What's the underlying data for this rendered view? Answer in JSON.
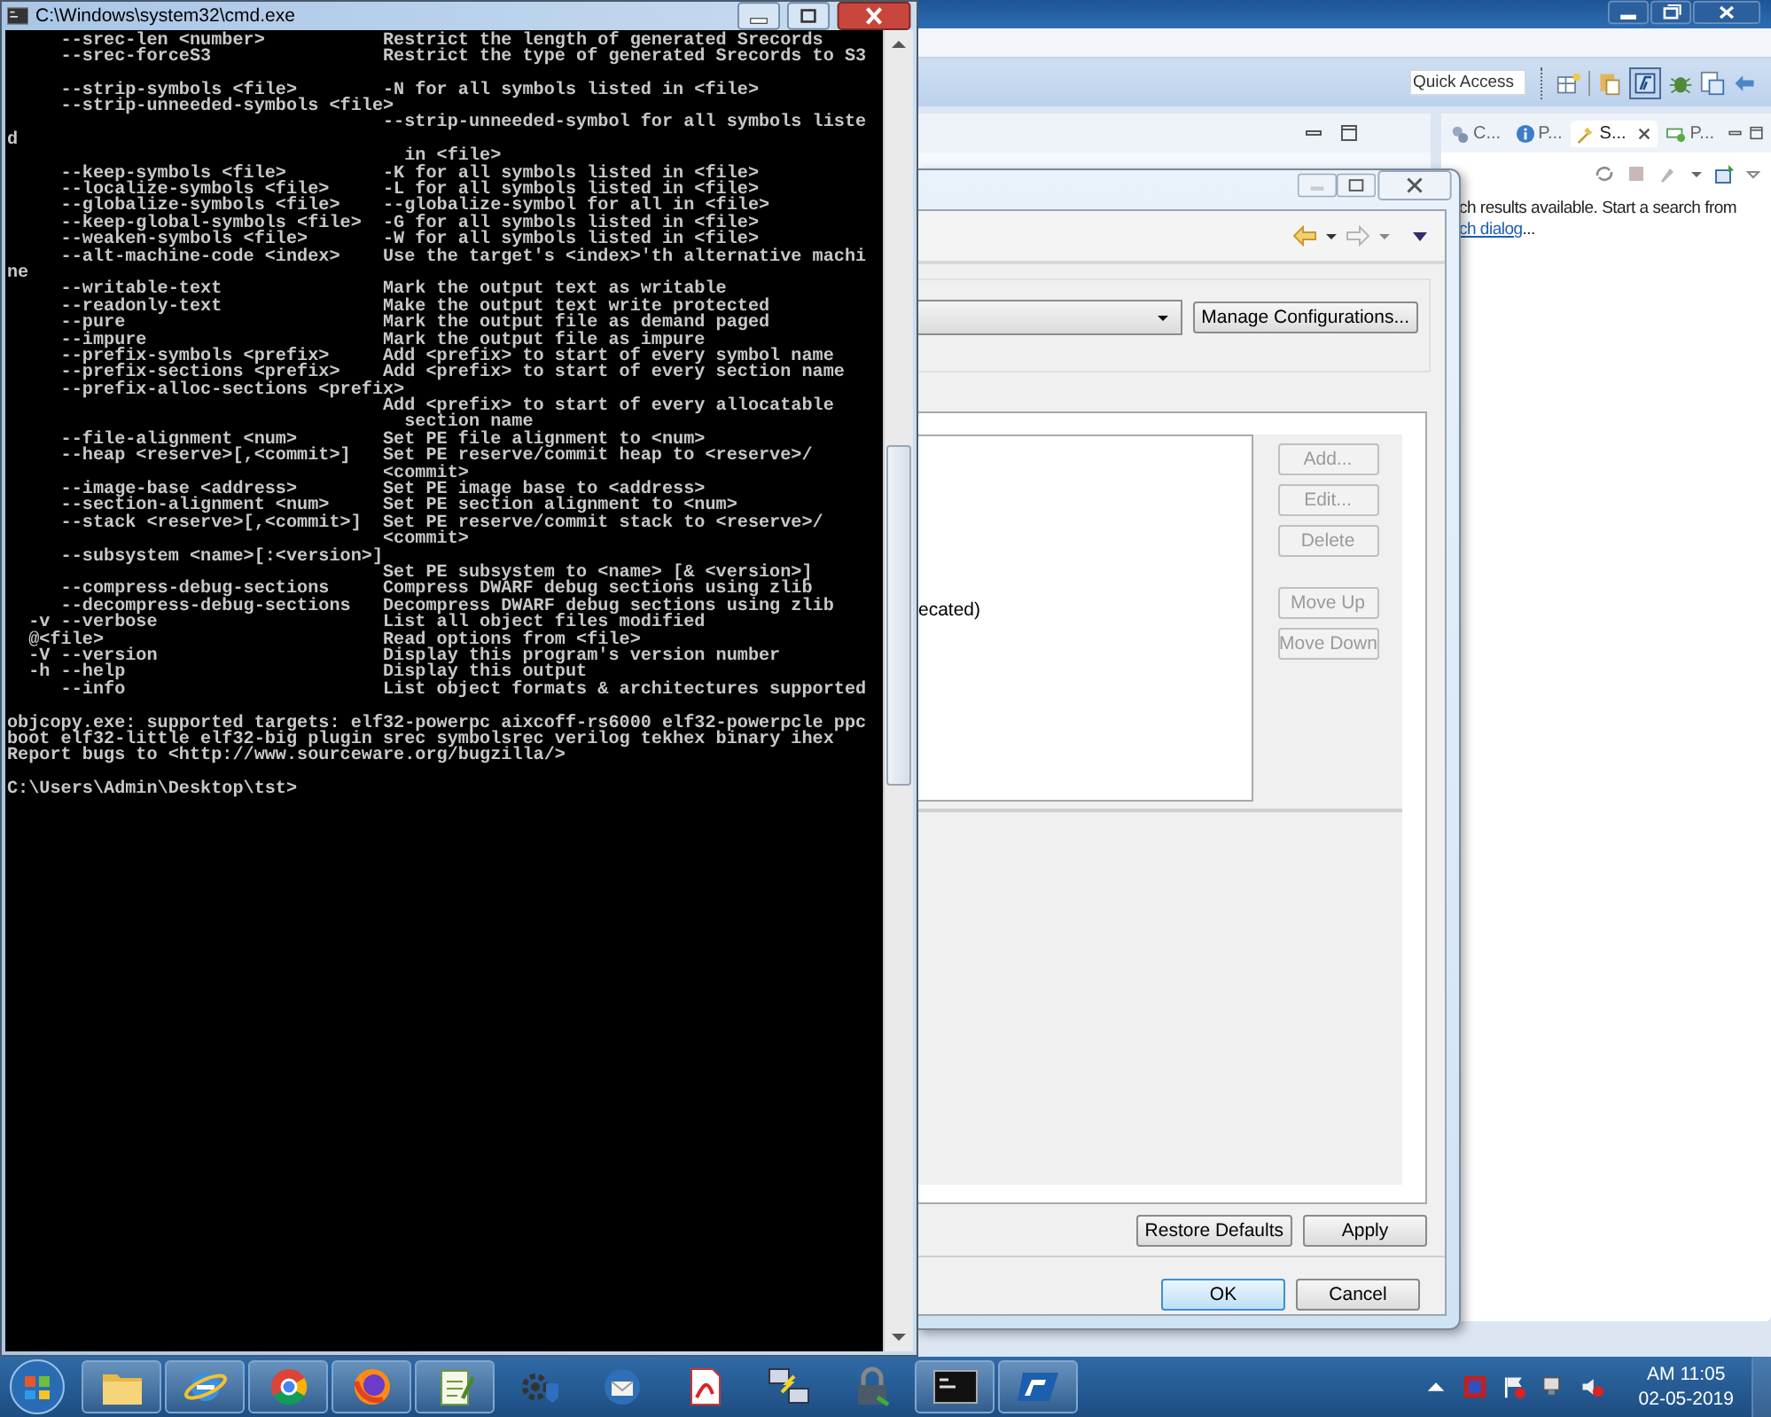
{
  "console": {
    "title": "C:\\Windows\\system32\\cmd.exe",
    "blocks": [
      [
        {
          "kind": "option",
          "option": "     --srec-len <number>",
          "description": "Restrict the length of generated Srecords"
        },
        {
          "kind": "option",
          "option": "     --srec-forceS3",
          "description": "Restrict the type of generated Srecords to S3"
        }
      ],
      [
        {
          "kind": "option",
          "option": "     --strip-symbols <file>",
          "description": "-N for all symbols listed in <file>"
        },
        {
          "kind": "option",
          "option": "     --strip-unneeded-symbols <file>"
        },
        {
          "kind": "continuation",
          "description": "--strip-unneeded-symbol for all symbols liste"
        },
        {
          "kind": "raw",
          "text": "d"
        },
        {
          "kind": "continuation",
          "description": "  in <file>"
        },
        {
          "kind": "option",
          "option": "     --keep-symbols <file>",
          "description": "-K for all symbols listed in <file>"
        },
        {
          "kind": "option",
          "option": "     --localize-symbols <file>",
          "description": "-L for all symbols listed in <file>"
        },
        {
          "kind": "option",
          "option": "     --globalize-symbols <file>",
          "description": "--globalize-symbol for all in <file>"
        },
        {
          "kind": "option",
          "option": "     --keep-global-symbols <file>",
          "description": "-G for all symbols listed in <file>"
        },
        {
          "kind": "option",
          "option": "     --weaken-symbols <file>",
          "description": "-W for all symbols listed in <file>"
        },
        {
          "kind": "option",
          "option": "     --alt-machine-code <index>",
          "description": "Use the target's <index>'th alternative machi"
        },
        {
          "kind": "raw",
          "text": "ne"
        },
        {
          "kind": "option",
          "option": "     --writable-text",
          "description": "Mark the output text as writable"
        },
        {
          "kind": "option",
          "option": "     --readonly-text",
          "description": "Make the output text write protected"
        },
        {
          "kind": "option",
          "option": "     --pure",
          "description": "Mark the output file as demand paged"
        },
        {
          "kind": "option",
          "option": "     --impure",
          "description": "Mark the output file as impure"
        },
        {
          "kind": "option",
          "option": "     --prefix-symbols <prefix>",
          "description": "Add <prefix> to start of every symbol name"
        },
        {
          "kind": "option",
          "option": "     --prefix-sections <prefix>",
          "description": "Add <prefix> to start of every section name"
        },
        {
          "kind": "option",
          "option": "     --prefix-alloc-sections <prefix>"
        },
        {
          "kind": "continuation",
          "description": "Add <prefix> to start of every allocatable"
        },
        {
          "kind": "continuation",
          "description": "  section name"
        },
        {
          "kind": "option",
          "option": "     --file-alignment <num>",
          "description": "Set PE file alignment to <num>"
        },
        {
          "kind": "option",
          "option": "     --heap <reserve>[,<commit>]",
          "description": "Set PE reserve/commit heap to <reserve>/"
        },
        {
          "kind": "continuation",
          "description": "<commit>"
        },
        {
          "kind": "option",
          "option": "     --image-base <address>",
          "description": "Set PE image base to <address>"
        },
        {
          "kind": "option",
          "option": "     --section-alignment <num>",
          "description": "Set PE section alignment to <num>"
        },
        {
          "kind": "option",
          "option": "     --stack <reserve>[,<commit>]",
          "description": "Set PE reserve/commit stack to <reserve>/"
        },
        {
          "kind": "continuation",
          "description": "<commit>"
        },
        {
          "kind": "option",
          "option": "     --subsystem <name>[:<version>]"
        },
        {
          "kind": "continuation",
          "description": "Set PE subsystem to <name> [& <version>]"
        },
        {
          "kind": "option",
          "option": "     --compress-debug-sections",
          "description": "Compress DWARF debug sections using zlib"
        },
        {
          "kind": "option",
          "option": "     --decompress-debug-sections",
          "description": "Decompress DWARF debug sections using zlib"
        },
        {
          "kind": "option",
          "option": "  -v --verbose",
          "description": "List all object files modified"
        },
        {
          "kind": "option",
          "option": "  @<file>",
          "description": "Read options from <file>"
        },
        {
          "kind": "option",
          "option": "  -V --version",
          "description": "Display this program's version number"
        },
        {
          "kind": "option",
          "option": "  -h --help",
          "description": "Display this output"
        },
        {
          "kind": "option",
          "option": "     --info",
          "description": "List object formats & architectures supported"
        }
      ],
      [
        {
          "kind": "raw",
          "text": "objcopy.exe: supported targets: elf32-powerpc aixcoff-rs6000 elf32-powerpcle ppc"
        },
        {
          "kind": "raw",
          "text": "boot elf32-little elf32-big plugin srec symbolsrec verilog tekhex binary ihex"
        },
        {
          "kind": "raw",
          "text": "Report bugs to <http://www.sourceware.org/bugzilla/>"
        }
      ],
      [
        {
          "kind": "raw",
          "text": "C:\\Users\\Admin\\Desktop\\tst>"
        }
      ]
    ]
  },
  "ide": {
    "quick_access": {
      "placeholder": "Quick Access"
    },
    "view_tabs": [
      {
        "kind": "gears",
        "label": "C...",
        "selected": false
      },
      {
        "kind": "info",
        "label": "P...",
        "selected": false
      },
      {
        "kind": "flashlight",
        "label": "S...",
        "selected": true
      },
      {
        "kind": "component",
        "label": "P...",
        "selected": false
      }
    ],
    "search_message": {
      "text": "ch results available. Start a search from",
      "link": "ch dialog",
      "after": "..."
    }
  },
  "dialog": {
    "manage_button": "Manage Configurations...",
    "list_text": "ecated)",
    "side_buttons": [
      {
        "label": "Add...",
        "disabled": true
      },
      {
        "label": "Edit...",
        "disabled": true
      },
      {
        "label": "Delete",
        "disabled": true
      },
      {
        "label": "Move Up",
        "disabled": true
      },
      {
        "label": "Move Down",
        "disabled": true
      }
    ],
    "restore_button": "Restore Defaults",
    "apply_button": "Apply",
    "ok_button": "OK",
    "cancel_button": "Cancel"
  },
  "taskbar": {
    "apps": [
      {
        "kind": "folder",
        "running": true
      },
      {
        "kind": "e-globe",
        "running": true
      },
      {
        "kind": "tricolor",
        "running": true
      },
      {
        "kind": "fox",
        "running": true
      },
      {
        "kind": "notepad",
        "running": true
      },
      {
        "kind": "gear",
        "running": false
      },
      {
        "kind": "mail",
        "running": false
      },
      {
        "kind": "document",
        "running": false
      },
      {
        "kind": "computers",
        "running": false
      },
      {
        "kind": "lock",
        "running": false
      },
      {
        "kind": "terminal",
        "running": true
      },
      {
        "kind": "logo",
        "running": true
      }
    ],
    "clock": {
      "time": "AM 11:05",
      "date": "02-05-2019"
    }
  }
}
